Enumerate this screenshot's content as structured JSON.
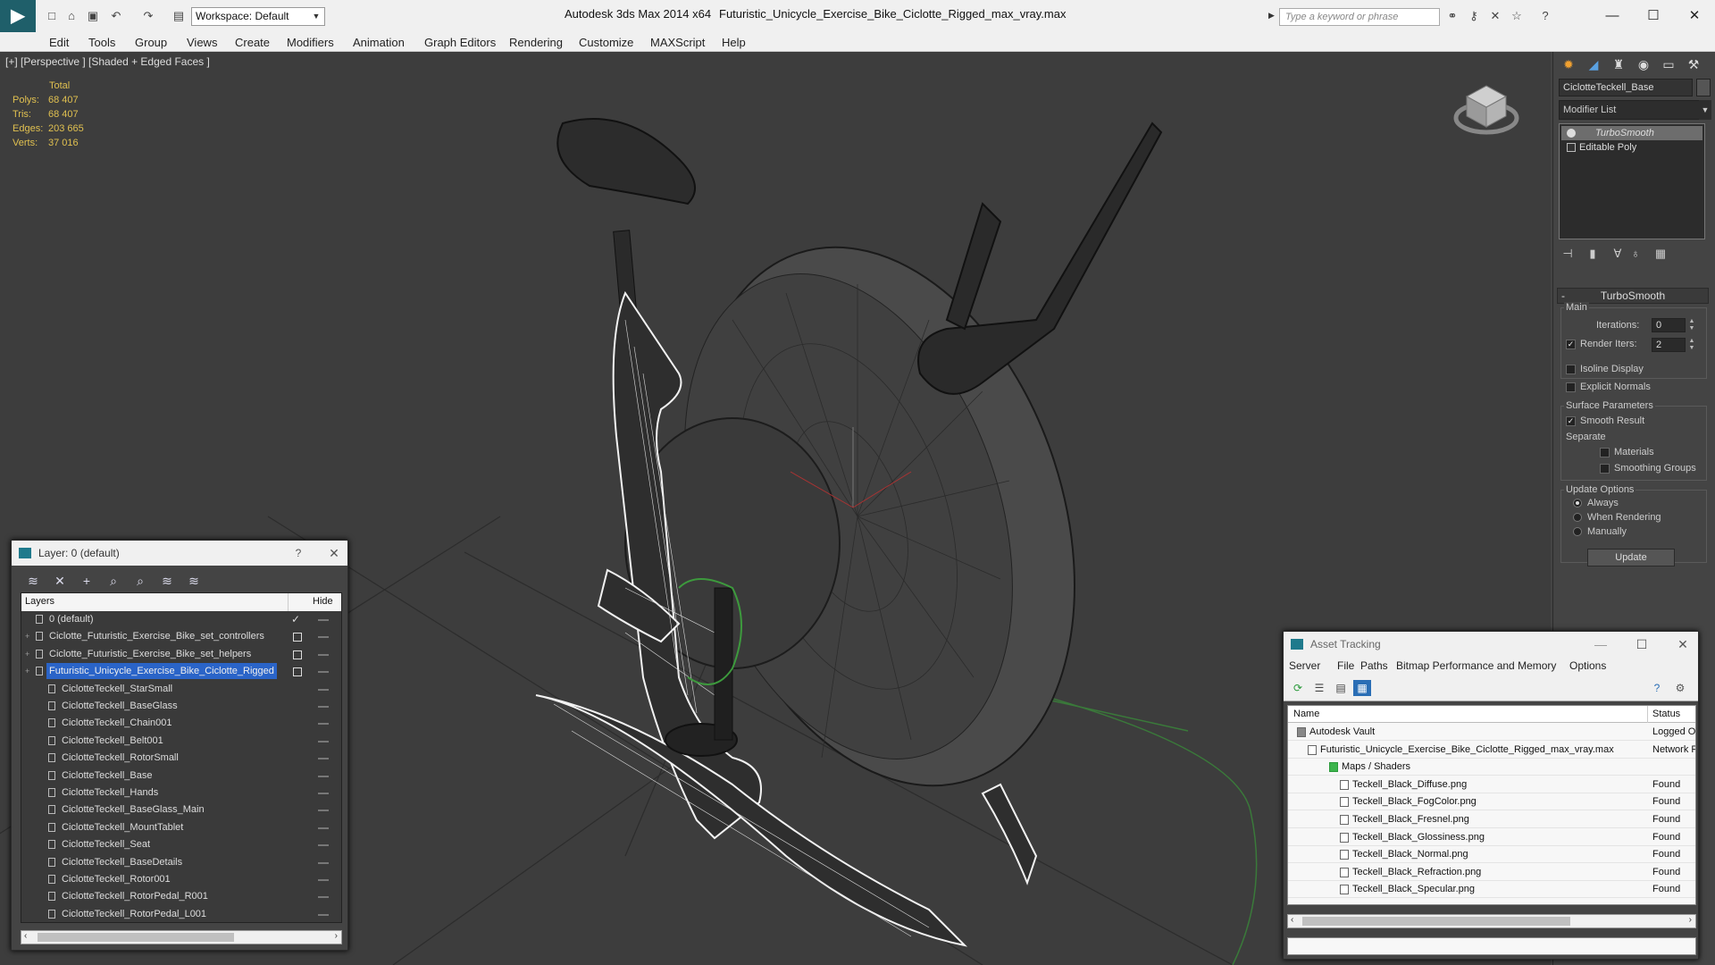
{
  "app": {
    "title": "Autodesk 3ds Max  2014 x64",
    "file": "Futuristic_Unicycle_Exercise_Bike_Ciclotte_Rigged_max_vray.max",
    "workspace": "Workspace: Default",
    "search_placeholder": "Type a keyword or phrase"
  },
  "menu": [
    "Edit",
    "Tools",
    "Group",
    "Views",
    "Create",
    "Modifiers",
    "Animation",
    "Graph Editors",
    "Rendering",
    "Customize",
    "MAXScript",
    "Help"
  ],
  "viewport": {
    "label": "[+] [Perspective ] [Shaded + Edged Faces ]",
    "stats": {
      "header": "Total",
      "rows": [
        {
          "label": "Polys:",
          "value": "68 407"
        },
        {
          "label": "Tris:",
          "value": "68 407"
        },
        {
          "label": "Edges:",
          "value": "203 665"
        },
        {
          "label": "Verts:",
          "value": "37 016"
        }
      ]
    }
  },
  "command_panel": {
    "object_name": "CiclotteTeckell_Base",
    "modifier_list": "Modifier List",
    "stack": [
      "TurboSmooth",
      "Editable Poly"
    ],
    "rollout_title": "TurboSmooth",
    "main_group": "Main",
    "iterations_label": "Iterations:",
    "iterations_value": "0",
    "render_iters_label": "Render Iters:",
    "render_iters_value": "2",
    "isoline": "Isoline Display",
    "explicit_normals": "Explicit Normals",
    "surface_group": "Surface Parameters",
    "smooth_result": "Smooth Result",
    "separate": "Separate",
    "materials": "Materials",
    "smoothing_groups": "Smoothing Groups",
    "update_group": "Update Options",
    "always": "Always",
    "when_rendering": "When Rendering",
    "manually": "Manually",
    "update_button": "Update"
  },
  "layer_dialog": {
    "title": "Layer: 0 (default)",
    "help": "?",
    "col_layers": "Layers",
    "col_hide": "Hide",
    "rows": [
      "0 (default)",
      "Ciclotte_Futuristic_Exercise_Bike_set_controllers",
      "Ciclotte_Futuristic_Exercise_Bike_set_helpers",
      "Futuristic_Unicycle_Exercise_Bike_Ciclotte_Rigged",
      "CiclotteTeckell_StarSmall",
      "CiclotteTeckell_BaseGlass",
      "CiclotteTeckell_Chain001",
      "CiclotteTeckell_Belt001",
      "CiclotteTeckell_RotorSmall",
      "CiclotteTeckell_Base",
      "CiclotteTeckell_Hands",
      "CiclotteTeckell_BaseGlass_Main",
      "CiclotteTeckell_MountTablet",
      "CiclotteTeckell_Seat",
      "CiclotteTeckell_BaseDetails",
      "CiclotteTeckell_Rotor001",
      "CiclotteTeckell_RotorPedal_R001",
      "CiclotteTeckell_RotorPedal_L001"
    ]
  },
  "asset_dialog": {
    "title": "Asset Tracking",
    "menu": [
      "Server",
      "File",
      "Paths",
      "Bitmap Performance and Memory",
      "Options"
    ],
    "col_name": "Name",
    "col_status": "Status",
    "rows": [
      {
        "name": "Autodesk Vault",
        "status": "Logged Ou"
      },
      {
        "name": "Futuristic_Unicycle_Exercise_Bike_Ciclotte_Rigged_max_vray.max",
        "status": "Network P"
      },
      {
        "name": "Maps / Shaders",
        "status": ""
      },
      {
        "name": "Teckell_Black_Diffuse.png",
        "status": "Found"
      },
      {
        "name": "Teckell_Black_FogColor.png",
        "status": "Found"
      },
      {
        "name": "Teckell_Black_Fresnel.png",
        "status": "Found"
      },
      {
        "name": "Teckell_Black_Glossiness.png",
        "status": "Found"
      },
      {
        "name": "Teckell_Black_Normal.png",
        "status": "Found"
      },
      {
        "name": "Teckell_Black_Refraction.png",
        "status": "Found"
      },
      {
        "name": "Teckell_Black_Specular.png",
        "status": "Found"
      }
    ]
  }
}
